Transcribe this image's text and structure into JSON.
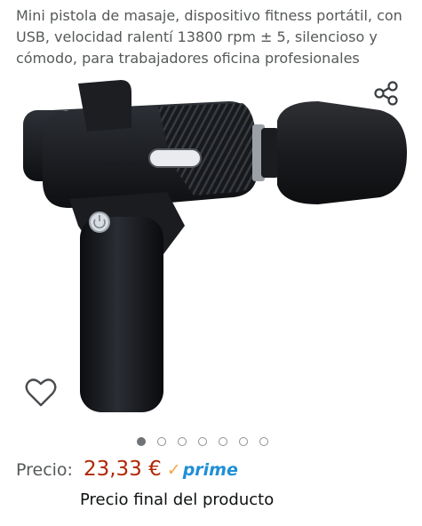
{
  "product": {
    "title": "Mini pistola de masaje, dispositivo fitness portátil, con USB, velocidad ralentí 13800 rpm ± 5, silencioso y cómodo, para trabajadores oficina profesionales"
  },
  "gallery": {
    "image_count": 7,
    "active_index": 0,
    "share_icon": "share-icon",
    "wishlist_icon": "heart-outline-icon"
  },
  "price": {
    "label": "Precio:",
    "value": "23,33 €",
    "prime_check": "✓",
    "prime_text": "prime",
    "final_note": "Precio final del producto"
  },
  "colors": {
    "price": "#b12704",
    "prime_blue": "#1f8fd6",
    "prime_check": "#f3a847"
  }
}
